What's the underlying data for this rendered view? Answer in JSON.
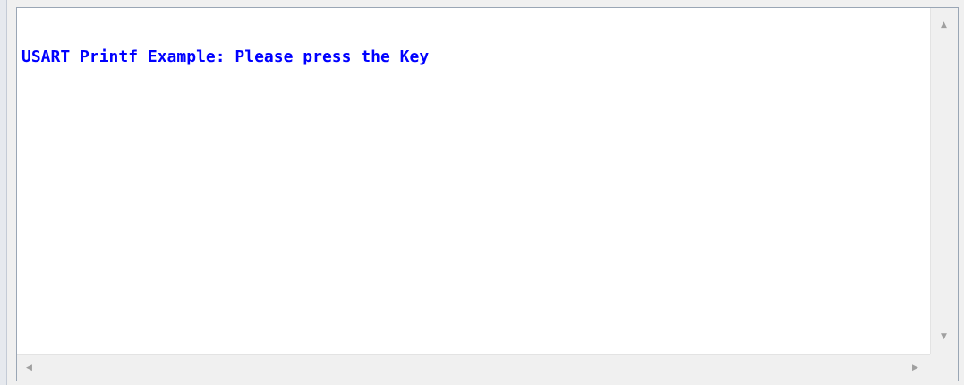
{
  "terminal": {
    "output_lines": [
      "USART Printf Example: Please press the Key"
    ],
    "text_color": "#0000ff"
  },
  "scrollbars": {
    "vertical": {
      "up_icon": "▲",
      "down_icon": "▼"
    },
    "horizontal": {
      "left_icon": "◀",
      "right_icon": "▶"
    }
  }
}
